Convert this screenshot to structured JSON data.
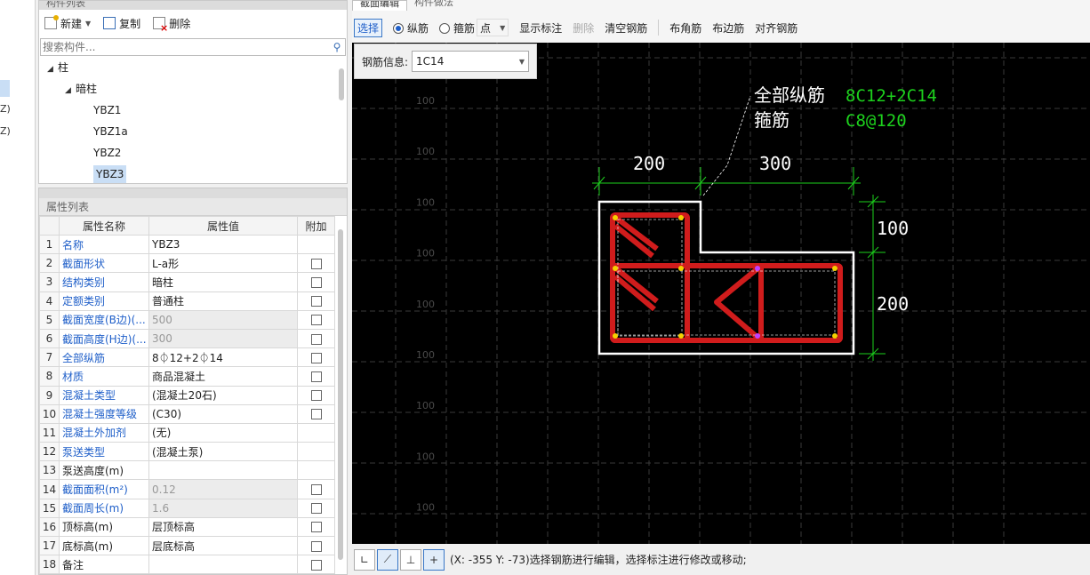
{
  "left_strip": {
    "z1": "Z)",
    "z2": "Z)"
  },
  "component_list": {
    "header": "构件列表",
    "toolbar": {
      "new_label": "新建",
      "copy_label": "复制",
      "delete_label": "删除"
    },
    "search_placeholder": "搜索构件...",
    "tree": [
      {
        "label": "柱",
        "level": 0,
        "expanded": true
      },
      {
        "label": "暗柱",
        "level": 1,
        "expanded": true
      },
      {
        "label": "YBZ1",
        "level": 2
      },
      {
        "label": "YBZ1a",
        "level": 2
      },
      {
        "label": "YBZ2",
        "level": 2
      },
      {
        "label": "YBZ3",
        "level": 2,
        "selected": true
      }
    ]
  },
  "property_list": {
    "header": "属性列表",
    "columns": {
      "name": "属性名称",
      "value": "属性值",
      "add": "附加"
    },
    "rows": [
      {
        "n": "1",
        "name": "名称",
        "value": "YBZ3",
        "color": "blue",
        "checkbox": false,
        "gray": false
      },
      {
        "n": "2",
        "name": "截面形状",
        "value": "L-a形",
        "color": "blue",
        "checkbox": true,
        "gray": false
      },
      {
        "n": "3",
        "name": "结构类别",
        "value": "暗柱",
        "color": "blue",
        "checkbox": true,
        "gray": false
      },
      {
        "n": "4",
        "name": "定额类别",
        "value": "普通柱",
        "color": "blue",
        "checkbox": true,
        "gray": false
      },
      {
        "n": "5",
        "name": "截面宽度(B边)(...",
        "value": "500",
        "color": "blue",
        "checkbox": true,
        "gray": true
      },
      {
        "n": "6",
        "name": "截面高度(H边)(...",
        "value": "300",
        "color": "blue",
        "checkbox": true,
        "gray": true
      },
      {
        "n": "7",
        "name": "全部纵筋",
        "value": "8⏀12+2⏀14",
        "color": "blue",
        "checkbox": true,
        "gray": false
      },
      {
        "n": "8",
        "name": "材质",
        "value": "商品混凝土",
        "color": "blue",
        "checkbox": true,
        "gray": false
      },
      {
        "n": "9",
        "name": "混凝土类型",
        "value": "(混凝土20石)",
        "color": "blue",
        "checkbox": true,
        "gray": false
      },
      {
        "n": "10",
        "name": "混凝土强度等级",
        "value": "(C30)",
        "color": "blue",
        "checkbox": true,
        "gray": false
      },
      {
        "n": "11",
        "name": "混凝土外加剂",
        "value": "(无)",
        "color": "blue",
        "checkbox": false,
        "gray": false
      },
      {
        "n": "12",
        "name": "泵送类型",
        "value": "(混凝土泵)",
        "color": "blue",
        "checkbox": false,
        "gray": false
      },
      {
        "n": "13",
        "name": "泵送高度(m)",
        "value": "",
        "color": "dark",
        "checkbox": false,
        "gray": false
      },
      {
        "n": "14",
        "name": "截面面积(m²)",
        "value": "0.12",
        "color": "blue",
        "checkbox": true,
        "gray": true
      },
      {
        "n": "15",
        "name": "截面周长(m)",
        "value": "1.6",
        "color": "blue",
        "checkbox": true,
        "gray": true
      },
      {
        "n": "16",
        "name": "顶标高(m)",
        "value": "层顶标高",
        "color": "dark",
        "checkbox": true,
        "gray": false
      },
      {
        "n": "17",
        "name": "底标高(m)",
        "value": "层底标高",
        "color": "dark",
        "checkbox": true,
        "gray": false
      },
      {
        "n": "18",
        "name": "备注",
        "value": "",
        "color": "dark",
        "checkbox": true,
        "gray": false
      }
    ]
  },
  "editor": {
    "tabs": [
      "截面编辑",
      "构件做法"
    ],
    "toolbar": {
      "select": "选择",
      "radio_longitudinal": "纵筋",
      "radio_stirrup": "箍筋",
      "point_select": "点",
      "show_annotation": "显示标注",
      "delete": "删除",
      "clear_rebar": "清空钢筋",
      "corner_rebar": "布角筋",
      "edge_rebar": "布边筋",
      "align_rebar": "对齐钢筋"
    },
    "rebar_info_label": "钢筋信息:",
    "rebar_info_value": "1C14",
    "grid_label": "100",
    "annotation": {
      "all_long_label": "全部纵筋",
      "all_long_value": "8C12+2C14",
      "stirrup_label": "箍筋",
      "stirrup_value": "C8@120",
      "dim_top_left": "200",
      "dim_top_right": "300",
      "dim_right_top": "100",
      "dim_right_bottom": "200"
    },
    "status_text": "(X: -355 Y: -73)选择钢筋进行编辑，选择标注进行修改或移动;",
    "colors": {
      "dim_green": "#1dd11d",
      "rebar_red": "#d01c1c",
      "outline": "#ffffff",
      "grid": "#3a3a3a"
    }
  }
}
